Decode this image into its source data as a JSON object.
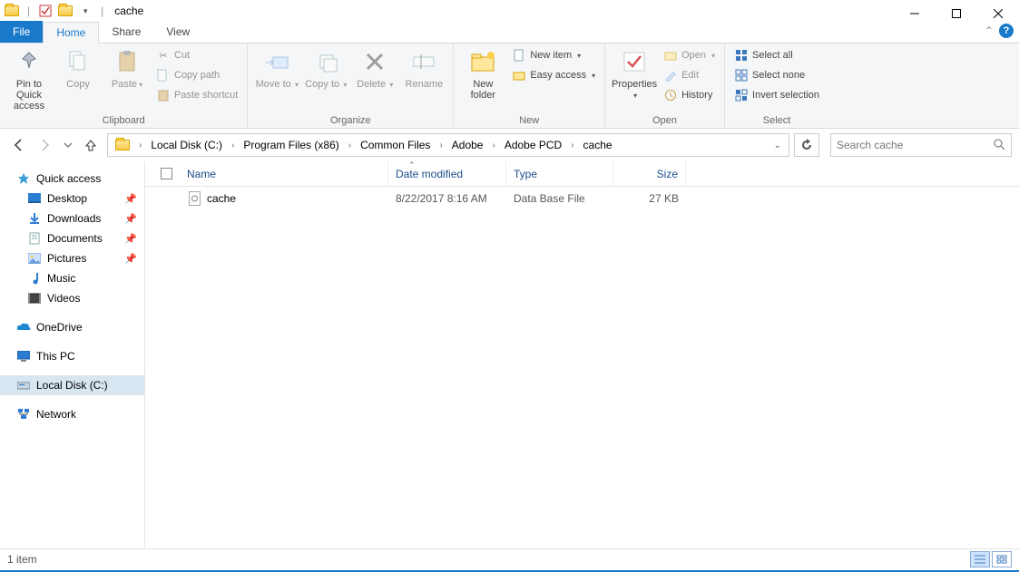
{
  "window": {
    "title": "cache"
  },
  "tabs": {
    "file": "File",
    "home": "Home",
    "share": "Share",
    "view": "View"
  },
  "ribbon": {
    "clipboard": {
      "label": "Clipboard",
      "pin": "Pin to Quick access",
      "copy": "Copy",
      "paste": "Paste",
      "cut": "Cut",
      "copy_path": "Copy path",
      "paste_shortcut": "Paste shortcut"
    },
    "organize": {
      "label": "Organize",
      "move_to": "Move to",
      "copy_to": "Copy to",
      "delete": "Delete",
      "rename": "Rename"
    },
    "new": {
      "label": "New",
      "new_folder": "New folder",
      "new_item": "New item",
      "easy_access": "Easy access"
    },
    "open": {
      "label": "Open",
      "properties": "Properties",
      "open": "Open",
      "edit": "Edit",
      "history": "History"
    },
    "select": {
      "label": "Select",
      "select_all": "Select all",
      "select_none": "Select none",
      "invert": "Invert selection"
    }
  },
  "breadcrumb": [
    "Local Disk (C:)",
    "Program Files (x86)",
    "Common Files",
    "Adobe",
    "Adobe PCD",
    "cache"
  ],
  "search": {
    "placeholder": "Search cache"
  },
  "nav": {
    "quick_access": "Quick access",
    "desktop": "Desktop",
    "downloads": "Downloads",
    "documents": "Documents",
    "pictures": "Pictures",
    "music": "Music",
    "videos": "Videos",
    "onedrive": "OneDrive",
    "this_pc": "This PC",
    "local_disk": "Local Disk (C:)",
    "network": "Network"
  },
  "columns": {
    "name": "Name",
    "date": "Date modified",
    "type": "Type",
    "size": "Size"
  },
  "files": [
    {
      "name": "cache",
      "date": "8/22/2017 8:16 AM",
      "type": "Data Base File",
      "size": "27 KB"
    }
  ],
  "status": {
    "count": "1 item"
  }
}
